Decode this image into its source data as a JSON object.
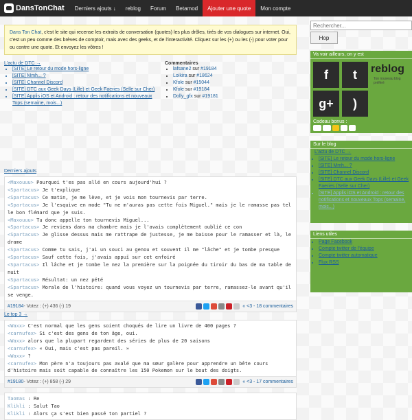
{
  "nav": {
    "logo": "DansTonChat",
    "items": [
      {
        "label": "Derniers ajouts ↓",
        "active": false
      },
      {
        "label": "reblog",
        "active": false
      },
      {
        "label": "Forum",
        "active": false
      },
      {
        "label": "Betamod",
        "active": false
      },
      {
        "label": "Ajouter une quote",
        "active": true
      },
      {
        "label": "Mon compte",
        "active": false
      }
    ]
  },
  "intro": {
    "site_name": "Dans Ton Chat",
    "text": ", c'est le site qui recense les extraits de conversation (quotes) les plus drôles, tirés de vos dialogues sur internet. Oui, c'est un peu comme des brèves de comptoir, mais avec des geeks, et de l'interactivité. Cliquez sur les (+) ou les (-) pour voter pour ou contre une quote. Et envoyez les vôtres !"
  },
  "actu": {
    "title": "L'actu de DTC →",
    "items": [
      "[SITE] Le retour du mode hors-ligne",
      "[SITE] Mmh... ?",
      "[SITE] Channel Discord",
      "[SITE] DTC aux Geek Days (Lille) et Geek Faeries (Selle sur Cher)",
      "[SITE] Applis iOS et Android : retour des notifications et nouveaux Tops (semaine, mois...)"
    ]
  },
  "comments": {
    "title": "Commentaires",
    "on": "sur",
    "items": [
      {
        "user": "lafsane2",
        "quote": "#19184"
      },
      {
        "user": "Loikira",
        "quote": "#18624"
      },
      {
        "user": "Kfole",
        "quote": "#15044"
      },
      {
        "user": "Kfole",
        "quote": "#19184"
      },
      {
        "user": "Dolly_gfx",
        "quote": "#19181"
      }
    ]
  },
  "latest": {
    "title": "Derniers ajouts",
    "lines": [
      {
        "nick": "<Maxouuu>",
        "text": " Pourquoi t'es pas allé en cours aujourd'hui ?"
      },
      {
        "nick": "<Spartacus>",
        "text": " Je t'explique"
      },
      {
        "nick": "<Spartacus>",
        "text": " Ce matin, je me lève, et je vois mon tournevis par terre."
      },
      {
        "nick": "<Spartacus>",
        "text": " Je l'esquive en mode \"Tu ne m'auras pas cette fois Miguel.\" mais je le ramasse pas tel le bon flémard que je suis."
      },
      {
        "nick": "<Maxouuu>",
        "text": " Tu donc appelle ton tournevis Miguel..."
      },
      {
        "nick": "<Spartacus>",
        "text": " Je reviens dans ma chambre mais je l'avais complètement oublié ce con"
      },
      {
        "nick": "<Spartacus>",
        "text": " Je glisse dessus mais me rattrape de justesse, je me baisse pour le ramasser et là, le drame"
      },
      {
        "nick": "<Spartacus>",
        "text": " Comme tu sais, j'ai un souci au genou et souvent il me \"lâche\" et je tombe presque"
      },
      {
        "nick": "<Spartacus>",
        "text": " Sauf cette fois, j'avais appuï sur cet enfoiré"
      },
      {
        "nick": "<Spartacus>",
        "text": " Il lâche et je tombe le nez la première sur la poignée du tiroir du bas de ma table de nuit"
      },
      {
        "nick": "<Spartacus>",
        "text": " Résultat: un nez pété"
      },
      {
        "nick": "<Spartacus>",
        "text": " Morale de l'histoire: quand vous voyez un tournevis par terre, ramassez-le avant qu'il se venge."
      }
    ],
    "footer": {
      "id": "#19184",
      "votes": " - Votez : (+) 436 (-) 19",
      "nav": "« <3 - 18 commentaires"
    }
  },
  "top3": {
    "title": "Le top 3 →",
    "lines": [
      {
        "nick": "<Waxx>",
        "text": " C'est normal que les gens soient choqués de lire un livre de 400 pages ?"
      },
      {
        "nick": "<carnufex>",
        "text": " Si c'est des gens de ton âge, oui."
      },
      {
        "nick": "<Waxx>",
        "text": " alors que la plupart regardent des séries de plus de 20 saisons"
      },
      {
        "nick": "<carnufex>",
        "text": " « Oui, mais c'est pas pareil. »"
      },
      {
        "nick": "<Waxx>",
        "text": " ?"
      },
      {
        "nick": "<carnufex>",
        "text": " Mon père n'a toujours pas avalé que ma sœur galère pour apprendre un bête cours d'histoire mais soit capable de connaître les 150 Pokemon sur le bout des doigts."
      }
    ],
    "footer": {
      "id": "#19180",
      "votes": " - Votez : (+) 858 (-) 29",
      "nav": "« <3 - 17 commentaires"
    }
  },
  "third": {
    "lines": [
      {
        "nick": "Taomas",
        "text": " : Re"
      },
      {
        "nick": "Klikli",
        "text": " : Salut Tao"
      },
      {
        "nick": "Klikli",
        "text": " : Alors ça s'est bien passé ton partiel ?"
      }
    ]
  },
  "sidebar": {
    "search_placeholder": "Rechercher...",
    "search_button": "Hop",
    "follow_title": "Va voir ailleurs, on y est",
    "reblog": "reblog",
    "reblog_sub": "Ton nouveau blog préféré",
    "bonus_title": "Cadeau bonus :",
    "blog_title": "Sur le blog",
    "blog_items": [
      "L'actu de DTC →",
      "[SITE] Le retour du mode hors-ligne",
      "[SITE] Mmh... ?",
      "[SITE] Channel Discord",
      "[SITE] DTC aux Geek Days (Lille) et Geek Faeries (Selle sur Cher)",
      "[SITE] Applis iOS et Android : retour des notifications et nouveaux Tops (semaine, mois...)"
    ],
    "links_title": "Liens utiles",
    "links": [
      "Page Facebook",
      "Compte twitter de l'équipe",
      "Compte twitter automatique",
      "Flux RSS"
    ]
  },
  "colors": {
    "nav_bg": "#2a2a2a",
    "accent_red": "#d9282b",
    "sidebar_green": "#6aa83f",
    "link_blue": "#1a5e9c"
  }
}
